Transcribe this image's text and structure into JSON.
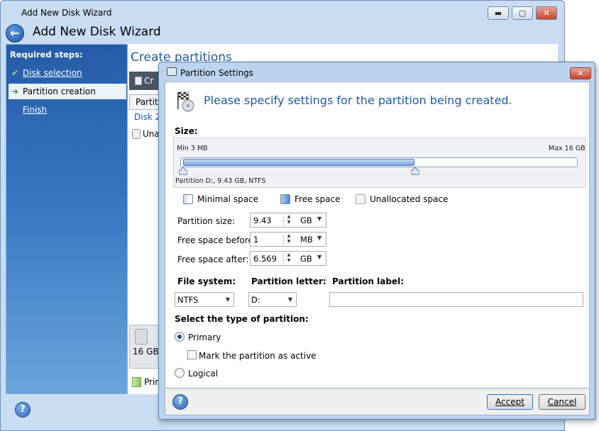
{
  "wizard": {
    "title": "Add New Disk Wizard",
    "heading": "Add New Disk Wizard",
    "minimize_glyph": "▬",
    "maximize_glyph": "▢",
    "close_glyph": "✕",
    "back_glyph": "←",
    "help_glyph": "?"
  },
  "sidebar": {
    "title": "Required steps:",
    "steps": [
      {
        "label": "Disk selection",
        "state": "done",
        "icon": "✔"
      },
      {
        "label": "Partition creation",
        "state": "current",
        "icon": "➔"
      },
      {
        "label": "Finish",
        "state": "pending",
        "icon": ""
      }
    ]
  },
  "main": {
    "title": "Create partitions",
    "toolbar_label": "Cr",
    "column_header": "Partiti",
    "disk_label": "Disk 2",
    "unallocated_row": "Una",
    "disk_size": "16 GB",
    "legend_primary": "Prim"
  },
  "dialog": {
    "title": "Partition Settings",
    "close_glyph": "✕",
    "heading": "Please specify settings for the partition being created.",
    "size_label": "Size:",
    "min_label": "Min 3 MB",
    "max_label": "Max 16 GB",
    "partition_caption": "Partition D:, 9.43 GB, NTFS",
    "legend": {
      "minimal": "Minimal space",
      "free": "Free space",
      "unallocated": "Unallocated space"
    },
    "fields": {
      "partition_size": {
        "label": "Partition size:",
        "value": "9.43",
        "unit": "GB"
      },
      "free_before": {
        "label": "Free space before:",
        "value": "1",
        "unit": "MB"
      },
      "free_after": {
        "label": "Free space after:",
        "value": "6.569",
        "unit": "GB"
      }
    },
    "file_system": {
      "label": "File system:",
      "value": "NTFS"
    },
    "partition_letter": {
      "label": "Partition letter:",
      "value": "D:"
    },
    "partition_label": {
      "label": "Partition label:",
      "value": ""
    },
    "type_title": "Select the type of partition:",
    "primary": {
      "label": "Primary",
      "selected": true
    },
    "mark_active": {
      "label": "Mark the partition as active",
      "checked": false
    },
    "logical": {
      "label": "Logical",
      "selected": false
    },
    "accept_label": "Accept",
    "cancel_label": "Cancel",
    "help_glyph": "?"
  },
  "colors": {
    "accent": "#1c5aa6",
    "sidebar_top": "#255ca8",
    "window_frame": "#c9dcf2"
  }
}
